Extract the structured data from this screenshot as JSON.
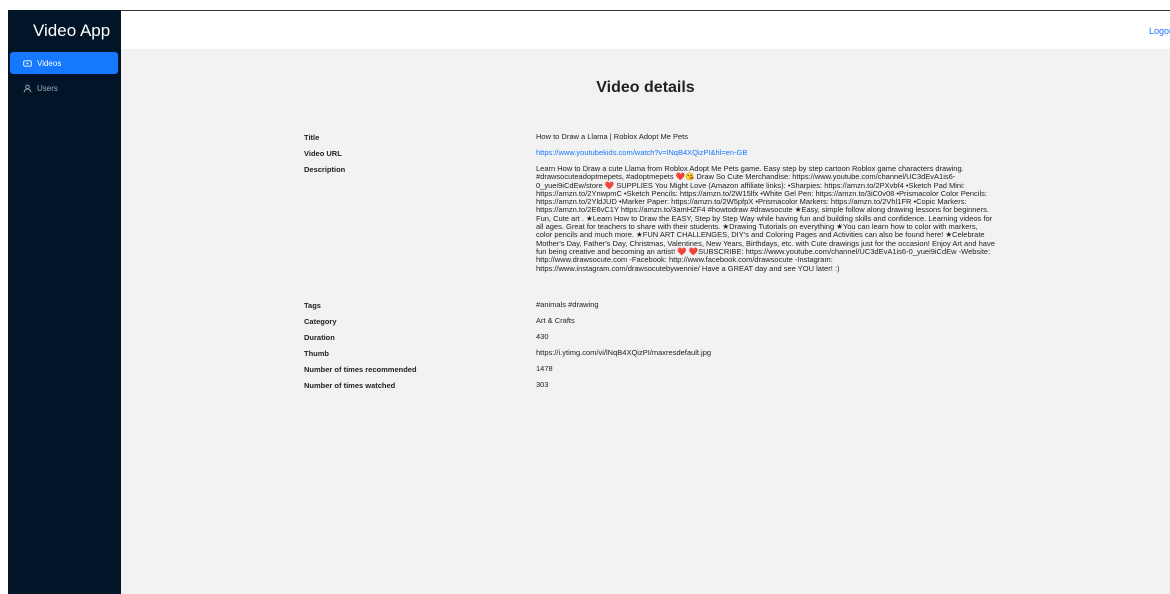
{
  "app": {
    "brand": "Video App",
    "logout_label": "Logou"
  },
  "sidebar": {
    "items": [
      {
        "label": "Videos",
        "icon": "video-icon",
        "active": true
      },
      {
        "label": "Users",
        "icon": "user-icon",
        "active": false
      }
    ]
  },
  "page": {
    "title": "Video details"
  },
  "details": {
    "title_label": "Title",
    "title_value": "How to Draw a Llama | Roblox Adopt Me Pets",
    "url_label": "Video URL",
    "url_value": "https://www.youtubekids.com/watch?v=lNqB4XQizPI&hl=en-GB",
    "description_label": "Description",
    "description_value": "Learn How to Draw a cute Llama from Roblox Adopt Me Pets game. Easy step by step cartoon Roblox game characters drawing. #drawsocuteadoptmepets, #adoptmepets ❤️😘 Draw So Cute Merchandise: https://www.youtube.com/channel/UC3dEvA1is6-0_yuei9iCdEw/store ❤️ SUPPLIES You Might Love (Amazon affiliate links): •Sharpies: https://amzn.to/2PXvbf4 •Sketch Pad Mini: https://amzn.to/2YnwpmC •Sketch Pencils: https://amzn.to/2W15lfx •White Gel Pen: https://amzn.to/3iC0v08 •Prismacolor Color Pencils: https://amzn.to/2YldJUD •Marker Paper: https://amzn.to/2W5pfpX •Prismacolor Markers: https://amzn.to/2Vhl1FR •Copic Markers: https://amzn.to/2E6vC1Y https://amzn.to/3amHZF4 #howtodraw #drawsocute ★Easy, simple follow along drawing lessons for beginners. Fun, Cute art . ★Learn How to Draw the EASY, Step by Step Way while having fun and building skills and confidence. Learning videos for all ages. Great for teachers to share with their students. ★Drawing Tutorials on everything ★You can learn how to color with markers, color pencils and much more. ★FUN ART CHALLENGES, DIY's and Coloring Pages and Activities can also be found here! ★Celebrate Mother's Day, Father's Day, Christmas, Valentines, New Years, Birthdays, etc. with Cute drawings just for the occasion! Enjoy Art and have fun being creative and becoming an artist! ❤️ ❤️SUBSCRIBE: https://www.youtube.com/channel/UC3dEvA1is6-0_yuei9iCdEw -Website: http://www.drawsocute.com -Facebook: http://www.facebook.com/drawsocute -Instagram: https://www.instagram.com/drawsocutebywennie/ Have a GREAT day and see YOU later! :)",
    "tags_label": "Tags",
    "tags_value": "#animals #drawing",
    "category_label": "Category",
    "category_value": "Art & Crafts",
    "duration_label": "Duration",
    "duration_value": "430",
    "thumb_label": "Thumb",
    "thumb_value": "https://i.ytimg.com/vi/lNqB4XQizPI/maxresdefault.jpg",
    "recommended_label": "Number of times recommended",
    "recommended_value": "1478",
    "watched_label": "Number of times watched",
    "watched_value": "303"
  },
  "colors": {
    "sidebar_bg": "#021428",
    "accent": "#1677ff",
    "content_bg": "#f2f2f2"
  }
}
